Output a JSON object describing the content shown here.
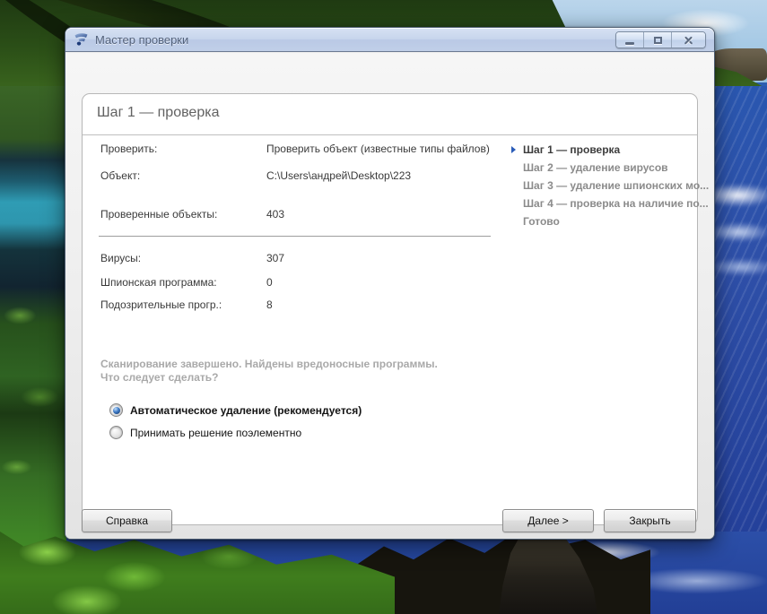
{
  "window": {
    "title": "Мастер проверки"
  },
  "wizard": {
    "heading": "Шаг 1 — проверка",
    "summary_rows": [
      {
        "label": "Проверить:",
        "value": "Проверить объект (известные типы файлов)"
      },
      {
        "label": "Объект:",
        "value": "C:\\Users\\андрей\\Desktop\\223"
      },
      {
        "label": "Проверенные объекты:",
        "value": "403"
      }
    ],
    "result_rows": [
      {
        "label": "Вирусы:",
        "value": "307"
      },
      {
        "label": "Шпионская программа:",
        "value": "0"
      },
      {
        "label": "Подозрительные прогр.:",
        "value": "8"
      }
    ],
    "steps": [
      {
        "label": "Шаг 1 — проверка",
        "active": true
      },
      {
        "label": "Шаг 2 — удаление вирусов",
        "active": false
      },
      {
        "label": "Шаг 3 — удаление шпионских мо...",
        "active": false
      },
      {
        "label": "Шаг 4 — проверка на наличие по...",
        "active": false
      },
      {
        "label": "Готово",
        "active": false
      }
    ],
    "status_line1": "Сканирование завершено. Найдены вредоносные программы.",
    "status_line2": "Что следует сделать?",
    "options": [
      {
        "label": "Автоматическое удаление (рекомендуется)",
        "selected": true
      },
      {
        "label": "Принимать решение поэлементно",
        "selected": false
      }
    ],
    "buttons": {
      "help": "Справка",
      "next": "Далее >",
      "close": "Закрыть"
    }
  },
  "colors": {
    "titlebar": "#c7d5ec",
    "accent_arrow": "#2a5cb8",
    "radio_selected": "#3d7ac6",
    "status_text": "#a9a9a9"
  }
}
